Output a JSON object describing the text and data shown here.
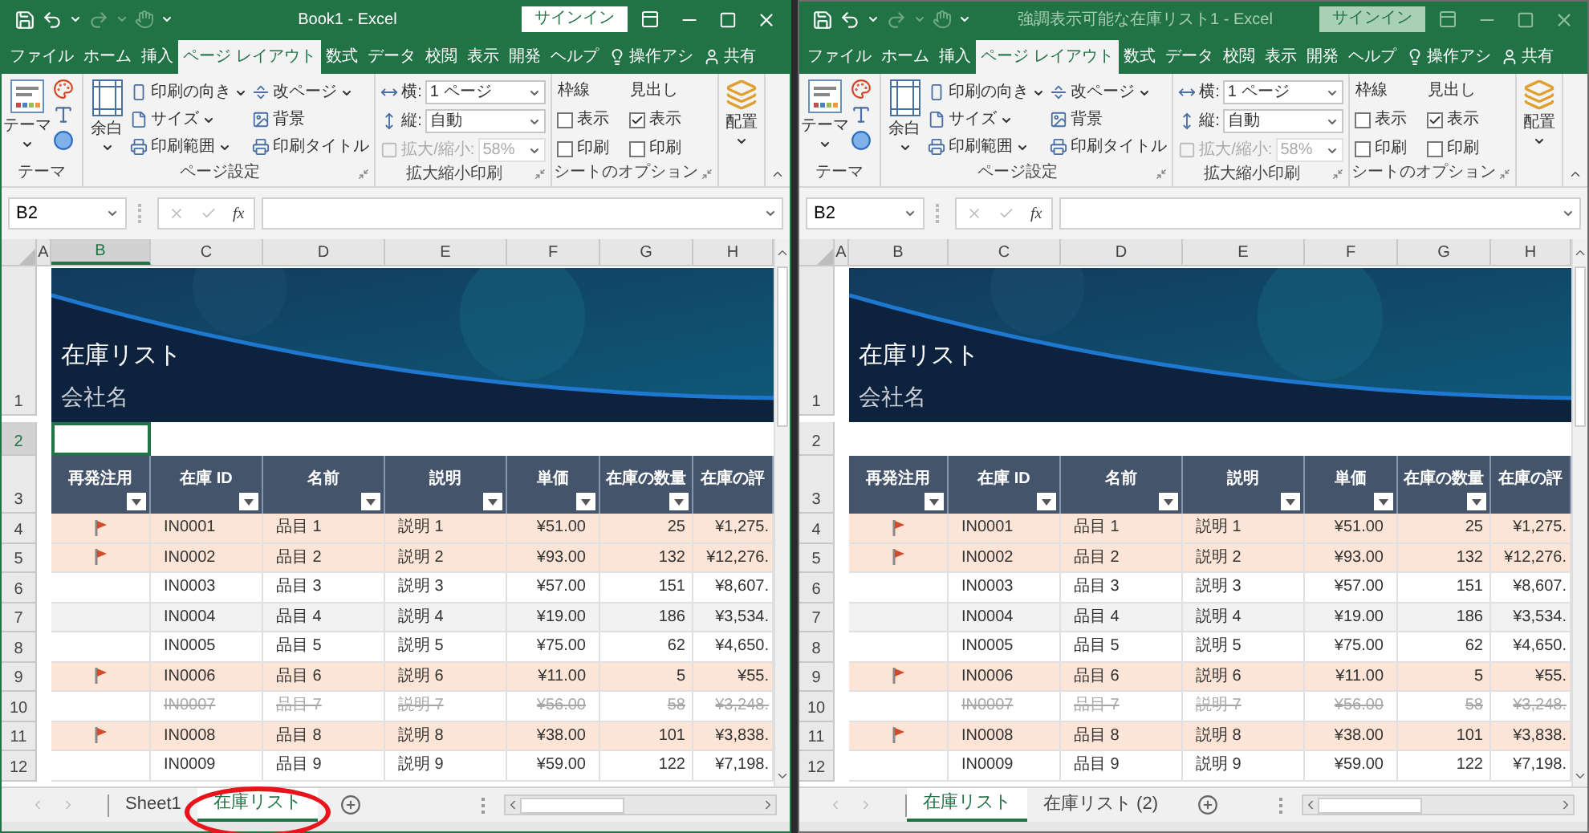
{
  "windows": [
    {
      "title": "Book1  -  Excel",
      "active": true,
      "signin": "サインイン",
      "tabs": [
        {
          "label": "ファイル",
          "selected": false
        },
        {
          "label": "ホーム",
          "selected": false
        },
        {
          "label": "挿入",
          "selected": false
        },
        {
          "label": "ページ レイアウト",
          "selected": true
        },
        {
          "label": "数式",
          "selected": false
        },
        {
          "label": "データ",
          "selected": false
        },
        {
          "label": "校閲",
          "selected": false
        },
        {
          "label": "表示",
          "selected": false
        },
        {
          "label": "開発",
          "selected": false
        },
        {
          "label": "ヘルプ",
          "selected": false
        }
      ],
      "tell_me": "操作アシ",
      "share": "共有",
      "ribbon": {
        "theme_button": "テーマ",
        "theme_group": "テーマ",
        "margins_button": "余白",
        "page_buttons": [
          {
            "label": "印刷の向き",
            "dropdown": true
          },
          {
            "label": "サイズ",
            "dropdown": true
          },
          {
            "label": "印刷範囲",
            "dropdown": true
          },
          {
            "label": "改ページ",
            "dropdown": true
          },
          {
            "label": "背景",
            "dropdown": false
          },
          {
            "label": "印刷タイトル",
            "dropdown": false
          }
        ],
        "page_group": "ページ設定",
        "scale_fields": [
          {
            "label": "横:",
            "value": "1 ページ",
            "disabled": false
          },
          {
            "label": "縦:",
            "value": "自動",
            "disabled": false
          },
          {
            "label": "拡大/縮小:",
            "value": "58%",
            "disabled": true
          }
        ],
        "scale_group": "拡大縮小印刷",
        "sheet_options": [
          {
            "title": "枠線",
            "options": [
              {
                "label": "表示",
                "checked": false
              },
              {
                "label": "印刷",
                "checked": false
              }
            ]
          },
          {
            "title": "見出し",
            "options": [
              {
                "label": "表示",
                "checked": true
              },
              {
                "label": "印刷",
                "checked": false
              }
            ]
          }
        ],
        "sheet_group": "シートのオプション",
        "arrange_button": "配置"
      },
      "name_box": "B2",
      "function_label": "fx",
      "sheet": {
        "column_letters": [
          {
            "label": "A",
            "selected": false
          },
          {
            "label": "B",
            "selected": true
          },
          {
            "label": "C",
            "selected": false
          },
          {
            "label": "D",
            "selected": false
          },
          {
            "label": "E",
            "selected": false
          },
          {
            "label": "F",
            "selected": false
          },
          {
            "label": "G",
            "selected": false
          },
          {
            "label": "H",
            "selected": false
          }
        ],
        "banner": {
          "row": "1",
          "title": "在庫リスト",
          "subtitle": "会社名"
        },
        "row2": {
          "row": "2",
          "selected": true
        },
        "header_row": "3"
      },
      "table": {
        "flag_column": {
          "label": "再発注用",
          "filter": true
        },
        "columns": [
          {
            "label": "在庫 ID",
            "filter": true
          },
          {
            "label": "名前",
            "filter": true
          },
          {
            "label": "説明",
            "filter": true
          },
          {
            "label": "単価",
            "filter": true
          },
          {
            "label": "在庫の数量",
            "filter": true
          },
          {
            "label": "在庫の評",
            "filter": false
          }
        ],
        "rows": [
          {
            "row": "4",
            "flag": true,
            "discontinued": false,
            "cells": [
              "IN0001",
              "品目 1",
              "説明 1",
              "¥51.00",
              "25",
              "¥1,275."
            ]
          },
          {
            "row": "5",
            "flag": true,
            "discontinued": false,
            "cells": [
              "IN0002",
              "品目 2",
              "説明 2",
              "¥93.00",
              "132",
              "¥12,276."
            ]
          },
          {
            "row": "6",
            "flag": false,
            "discontinued": false,
            "cells": [
              "IN0003",
              "品目 3",
              "説明 3",
              "¥57.00",
              "151",
              "¥8,607."
            ]
          },
          {
            "row": "7",
            "flag": false,
            "discontinued": false,
            "cells": [
              "IN0004",
              "品目 4",
              "説明 4",
              "¥19.00",
              "186",
              "¥3,534."
            ]
          },
          {
            "row": "8",
            "flag": false,
            "discontinued": false,
            "cells": [
              "IN0005",
              "品目 5",
              "説明 5",
              "¥75.00",
              "62",
              "¥4,650."
            ]
          },
          {
            "row": "9",
            "flag": true,
            "discontinued": false,
            "cells": [
              "IN0006",
              "品目 6",
              "説明 6",
              "¥11.00",
              "5",
              "¥55."
            ]
          },
          {
            "row": "10",
            "flag": false,
            "discontinued": true,
            "cells": [
              "IN0007",
              "品目 7",
              "説明 7",
              "¥56.00",
              "58",
              "¥3,248."
            ]
          },
          {
            "row": "11",
            "flag": true,
            "discontinued": false,
            "cells": [
              "IN0008",
              "品目 8",
              "説明 8",
              "¥38.00",
              "101",
              "¥3,838."
            ]
          },
          {
            "row": "12",
            "flag": false,
            "discontinued": false,
            "cells": [
              "IN0009",
              "品目 9",
              "説明 9",
              "¥59.00",
              "122",
              "¥7,198."
            ]
          }
        ]
      },
      "sheet_tabs": [
        {
          "label": "Sheet1",
          "selected": false,
          "circled": false
        },
        {
          "label": "在庫リスト",
          "selected": true,
          "circled": true
        }
      ]
    },
    {
      "title": "強調表示可能な在庫リスト1  -  Excel",
      "active": false,
      "signin": "サインイン",
      "tabs": [
        {
          "label": "ファイル",
          "selected": false
        },
        {
          "label": "ホーム",
          "selected": false
        },
        {
          "label": "挿入",
          "selected": false
        },
        {
          "label": "ページ レイアウト",
          "selected": true
        },
        {
          "label": "数式",
          "selected": false
        },
        {
          "label": "データ",
          "selected": false
        },
        {
          "label": "校閲",
          "selected": false
        },
        {
          "label": "表示",
          "selected": false
        },
        {
          "label": "開発",
          "selected": false
        },
        {
          "label": "ヘルプ",
          "selected": false
        }
      ],
      "tell_me": "操作アシ",
      "share": "共有",
      "ribbon": {
        "theme_button": "テーマ",
        "theme_group": "テーマ",
        "margins_button": "余白",
        "page_buttons": [
          {
            "label": "印刷の向き",
            "dropdown": true
          },
          {
            "label": "サイズ",
            "dropdown": true
          },
          {
            "label": "印刷範囲",
            "dropdown": true
          },
          {
            "label": "改ページ",
            "dropdown": true
          },
          {
            "label": "背景",
            "dropdown": false
          },
          {
            "label": "印刷タイトル",
            "dropdown": false
          }
        ],
        "page_group": "ページ設定",
        "scale_fields": [
          {
            "label": "横:",
            "value": "1 ページ",
            "disabled": false
          },
          {
            "label": "縦:",
            "value": "自動",
            "disabled": false
          },
          {
            "label": "拡大/縮小:",
            "value": "58%",
            "disabled": true
          }
        ],
        "scale_group": "拡大縮小印刷",
        "sheet_options": [
          {
            "title": "枠線",
            "options": [
              {
                "label": "表示",
                "checked": false
              },
              {
                "label": "印刷",
                "checked": false
              }
            ]
          },
          {
            "title": "見出し",
            "options": [
              {
                "label": "表示",
                "checked": true
              },
              {
                "label": "印刷",
                "checked": false
              }
            ]
          }
        ],
        "sheet_group": "シートのオプション",
        "arrange_button": "配置"
      },
      "name_box": "B2",
      "function_label": "fx",
      "sheet": {
        "column_letters": [
          {
            "label": "A",
            "selected": false
          },
          {
            "label": "B",
            "selected": false
          },
          {
            "label": "C",
            "selected": false
          },
          {
            "label": "D",
            "selected": false
          },
          {
            "label": "E",
            "selected": false
          },
          {
            "label": "F",
            "selected": false
          },
          {
            "label": "G",
            "selected": false
          },
          {
            "label": "H",
            "selected": false
          }
        ],
        "banner": {
          "row": "1",
          "title": "在庫リスト",
          "subtitle": "会社名"
        },
        "row2": {
          "row": "2",
          "selected": false
        },
        "header_row": "3"
      },
      "table": {
        "flag_column": {
          "label": "再発注用",
          "filter": true
        },
        "columns": [
          {
            "label": "在庫 ID",
            "filter": true
          },
          {
            "label": "名前",
            "filter": true
          },
          {
            "label": "説明",
            "filter": true
          },
          {
            "label": "単価",
            "filter": true
          },
          {
            "label": "在庫の数量",
            "filter": true
          },
          {
            "label": "在庫の評",
            "filter": false
          }
        ],
        "rows": [
          {
            "row": "4",
            "flag": true,
            "discontinued": false,
            "cells": [
              "IN0001",
              "品目 1",
              "説明 1",
              "¥51.00",
              "25",
              "¥1,275."
            ]
          },
          {
            "row": "5",
            "flag": true,
            "discontinued": false,
            "cells": [
              "IN0002",
              "品目 2",
              "説明 2",
              "¥93.00",
              "132",
              "¥12,276."
            ]
          },
          {
            "row": "6",
            "flag": false,
            "discontinued": false,
            "cells": [
              "IN0003",
              "品目 3",
              "説明 3",
              "¥57.00",
              "151",
              "¥8,607."
            ]
          },
          {
            "row": "7",
            "flag": false,
            "discontinued": false,
            "cells": [
              "IN0004",
              "品目 4",
              "説明 4",
              "¥19.00",
              "186",
              "¥3,534."
            ]
          },
          {
            "row": "8",
            "flag": false,
            "discontinued": false,
            "cells": [
              "IN0005",
              "品目 5",
              "説明 5",
              "¥75.00",
              "62",
              "¥4,650."
            ]
          },
          {
            "row": "9",
            "flag": true,
            "discontinued": false,
            "cells": [
              "IN0006",
              "品目 6",
              "説明 6",
              "¥11.00",
              "5",
              "¥55."
            ]
          },
          {
            "row": "10",
            "flag": false,
            "discontinued": true,
            "cells": [
              "IN0007",
              "品目 7",
              "説明 7",
              "¥56.00",
              "58",
              "¥3,248."
            ]
          },
          {
            "row": "11",
            "flag": true,
            "discontinued": false,
            "cells": [
              "IN0008",
              "品目 8",
              "説明 8",
              "¥38.00",
              "101",
              "¥3,838."
            ]
          },
          {
            "row": "12",
            "flag": false,
            "discontinued": false,
            "cells": [
              "IN0009",
              "品目 9",
              "説明 9",
              "¥59.00",
              "122",
              "¥7,198."
            ]
          }
        ]
      },
      "sheet_tabs": [
        {
          "label": "在庫リスト",
          "selected": true,
          "circled": false
        },
        {
          "label": "在庫リスト (2)",
          "selected": false,
          "circled": false
        }
      ]
    }
  ]
}
